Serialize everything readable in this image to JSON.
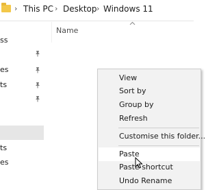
{
  "address_bar": {
    "separators": [
      "›",
      "›",
      "›"
    ],
    "crumbs": [
      "This PC",
      "Desktop",
      "Windows 11"
    ]
  },
  "nav_pane": {
    "items": [
      {
        "label": "ss",
        "pinned": false
      },
      {
        "label": "",
        "pinned": true
      },
      {
        "label": "es",
        "pinned": true
      },
      {
        "label": "ts",
        "pinned": true
      },
      {
        "label": "",
        "pinned": true
      },
      {
        "label": "",
        "pinned": false,
        "selected": true
      },
      {
        "label": "ts",
        "pinned": false
      },
      {
        "label": "es",
        "pinned": false
      }
    ]
  },
  "content": {
    "column_header": "Name"
  },
  "context_menu": {
    "items": [
      {
        "label": "View"
      },
      {
        "label": "Sort by"
      },
      {
        "label": "Group by"
      },
      {
        "label": "Refresh"
      },
      {
        "label": "Customise this folder..."
      },
      {
        "label": "Paste",
        "hover": true
      },
      {
        "label": "Paste shortcut"
      },
      {
        "label": "Undo Rename"
      }
    ]
  },
  "colors": {
    "folder": "#f3c84a",
    "menu_bg": "#f2f2f2",
    "menu_hover": "#ffffff",
    "nav_selected": "#e6e6e6"
  }
}
